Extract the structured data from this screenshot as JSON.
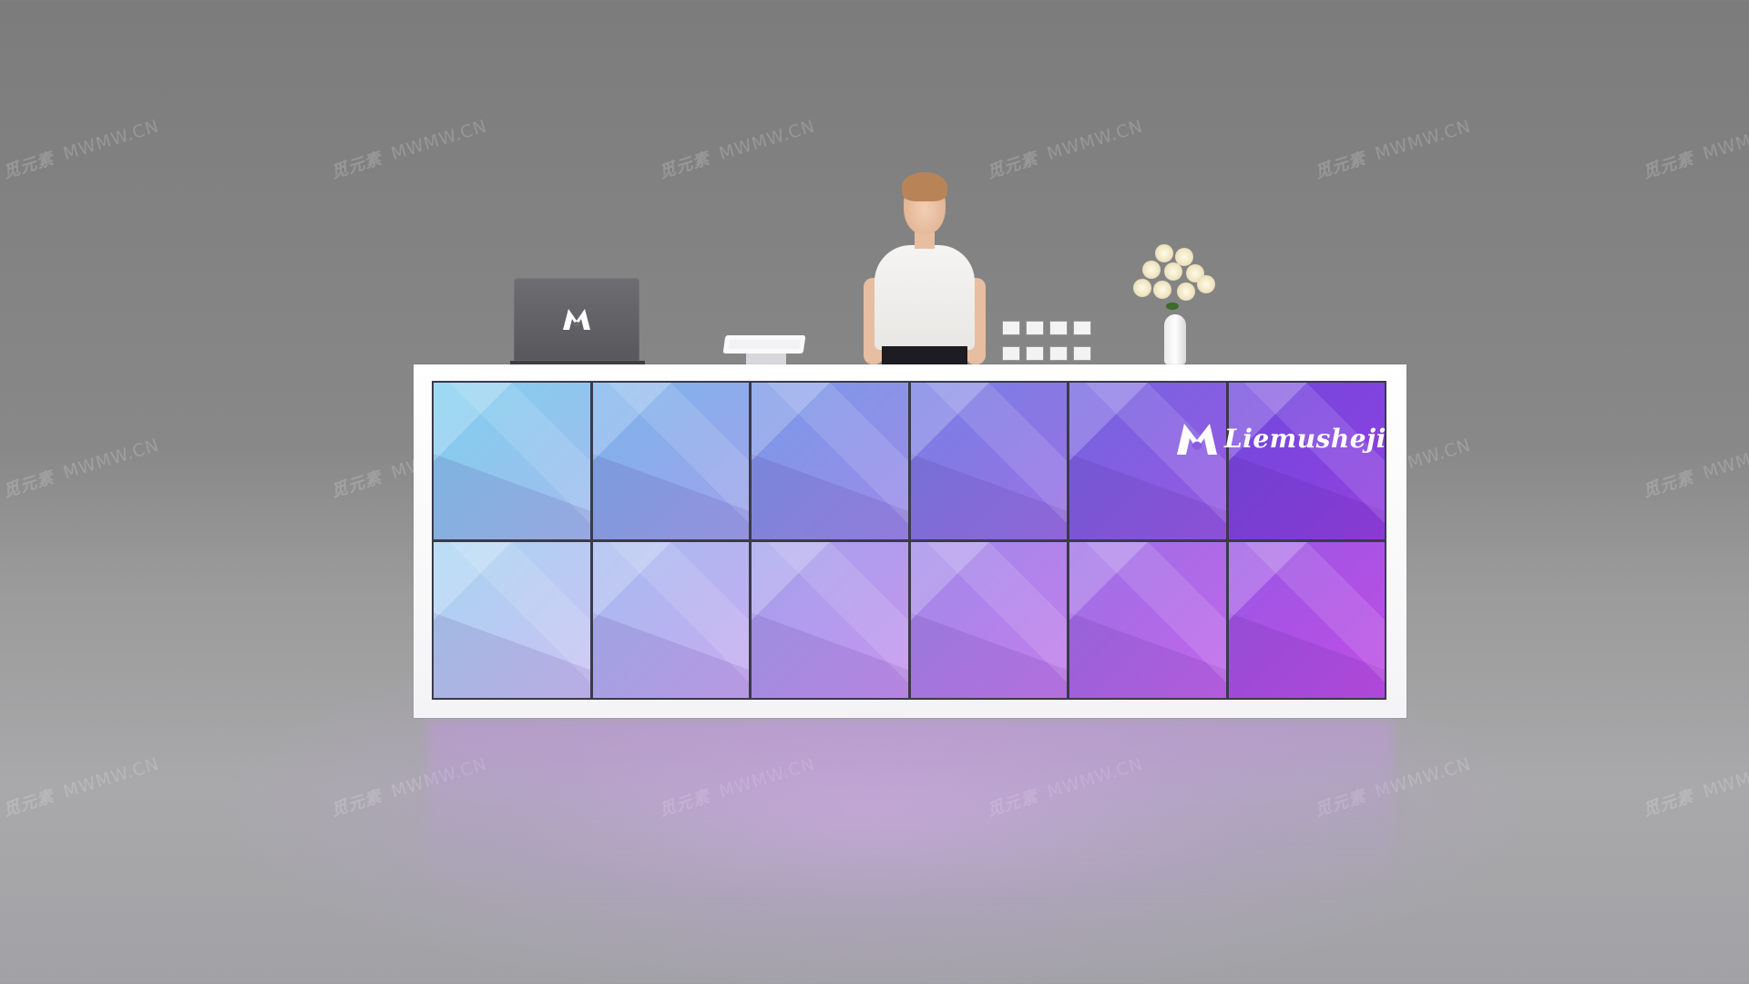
{
  "watermark": {
    "cn_text": "觅元素",
    "site_text": "MWMW.CN"
  },
  "counter": {
    "brand_name": "Liemusheji",
    "logo_letter": "M",
    "colors": {
      "wall_top_left": "#7fd0ee",
      "wall_top_right": "#6a2fd8",
      "wall_bottom_left": "#cdd9f5",
      "wall_bottom_right": "#c04ee6",
      "frame": "#ffffff"
    }
  },
  "laptop": {
    "logo_letter": "M"
  }
}
